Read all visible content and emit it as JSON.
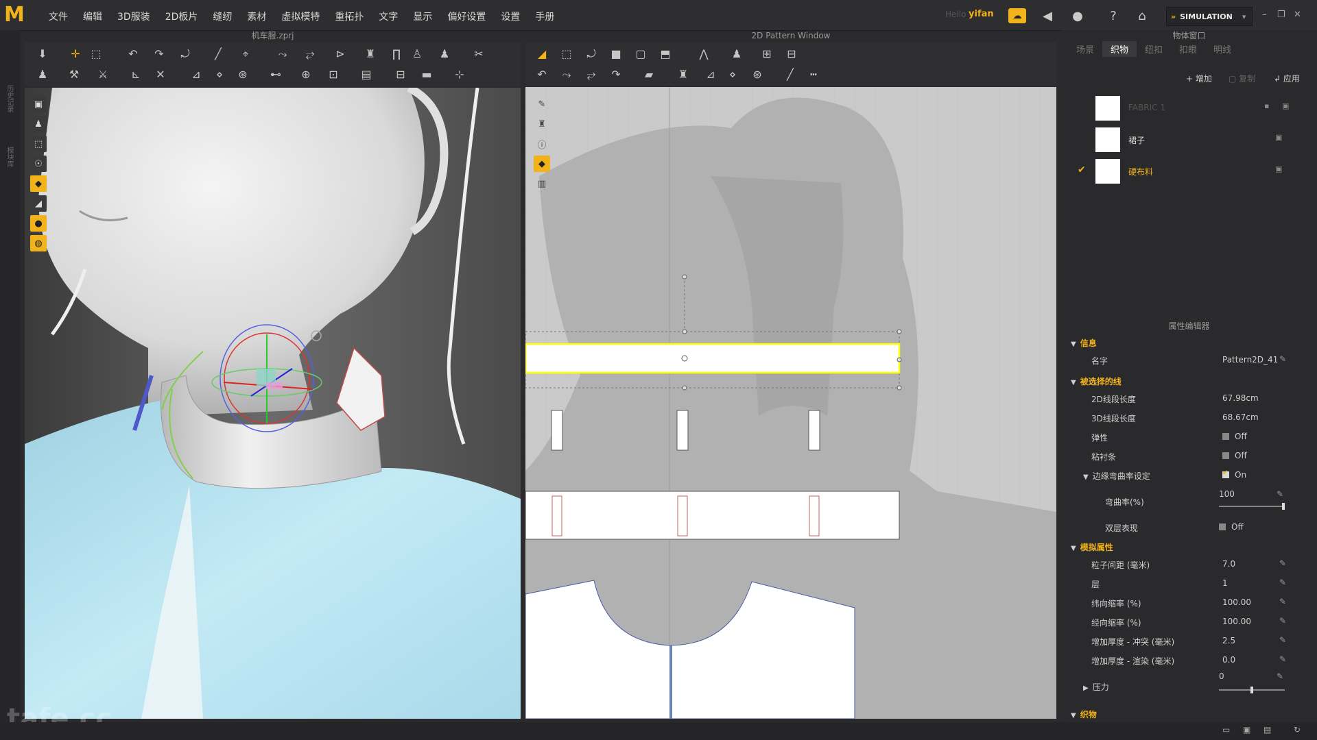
{
  "app": {
    "logo": "M",
    "menu": [
      "文件",
      "编辑",
      "3D服装",
      "2D板片",
      "缝纫",
      "素材",
      "虚拟模特",
      "重拓扑",
      "文字",
      "显示",
      "偏好设置",
      "设置",
      "手册"
    ],
    "hello": "Hello",
    "username": "yifan",
    "mode": "SIMULATION"
  },
  "left_strip": {
    "labels": [
      "历史记录",
      "模块库"
    ]
  },
  "view3d": {
    "title": "机车服.zprj",
    "watermark": "tafe.cc"
  },
  "view2d": {
    "title": "2D Pattern Window"
  },
  "object_window": {
    "title": "物体窗口",
    "tabs": [
      "场景",
      "织物",
      "纽扣",
      "扣眼",
      "明线"
    ],
    "active_tab": "织物",
    "add_label": "增加",
    "copy_label": "复制",
    "apply_label": "应用",
    "fabrics": [
      {
        "name": "FABRIC 1",
        "state": "dim"
      },
      {
        "name": "裙子",
        "state": "normal"
      },
      {
        "name": "硬布料",
        "state": "selected"
      }
    ]
  },
  "property_editor": {
    "title": "属性编辑器",
    "sections": {
      "info": "信息",
      "selected_line": "被选择的线",
      "sim_props": "模拟属性",
      "fabric": "织物"
    },
    "name_label": "名字",
    "name_value": "Pattern2D_41",
    "len2d_label": "2D线段长度",
    "len2d_value": "67.98cm",
    "len3d_label": "3D线段长度",
    "len3d_value": "68.67cm",
    "elastic_label": "弹性",
    "elastic_value": "Off",
    "fuse_label": "粘衬条",
    "fuse_value": "Off",
    "curvature_group": "边缘弯曲率设定",
    "curvature_group_value": "On",
    "curvature_label": "弯曲率(%)",
    "curvature_value": "100",
    "curvature_fraction": 1.0,
    "double_label": "双层表现",
    "double_value": "Off",
    "particle_label": "粒子间距 (毫米)",
    "particle_value": "7.0",
    "layer_label": "层",
    "layer_value": "1",
    "weft_label": "纬向缩率 (%)",
    "weft_value": "100.00",
    "warp_label": "经向缩率 (%)",
    "warp_value": "100.00",
    "thick_collide_label": "增加厚度 - 冲突 (毫米)",
    "thick_collide_value": "2.5",
    "thick_render_label": "增加厚度 - 渲染 (毫米)",
    "thick_render_value": "0.0",
    "pressure_label": "压力",
    "pressure_value": "0",
    "pressure_fraction": 0.5
  },
  "colors": {
    "accent": "#f2b21a",
    "selection_yellow": "#ffff00",
    "shirt": "#bfe6f2"
  }
}
